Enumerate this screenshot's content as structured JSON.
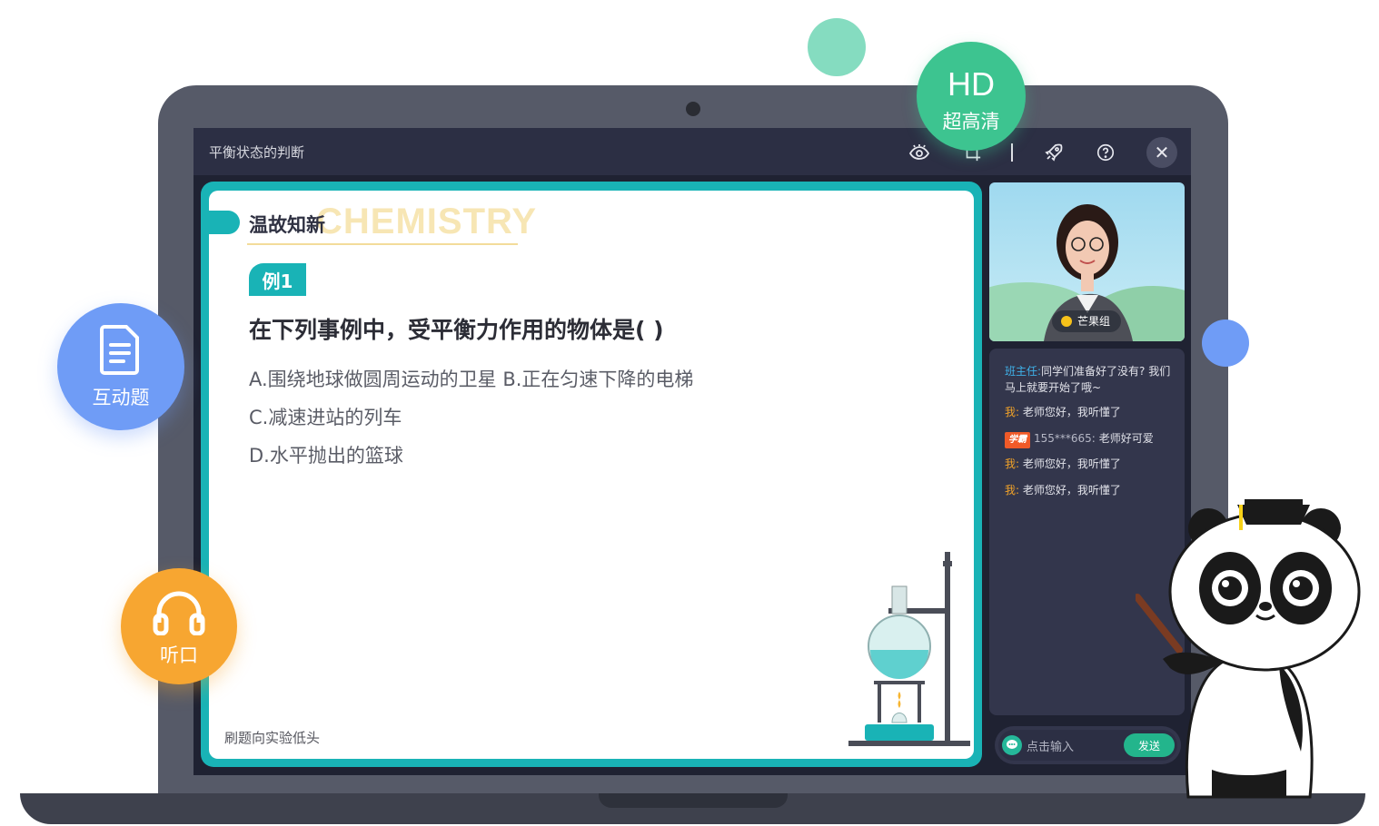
{
  "window": {
    "title": "平衡状态的判断"
  },
  "toolbar": {
    "icons": [
      "eye-icon",
      "crop-icon",
      "rocket-icon",
      "help-icon"
    ],
    "close_glyph": "✕"
  },
  "slide": {
    "section_title": "温故知新",
    "watermark": "CHEMISTRY",
    "example_label": "例1",
    "question": "在下列事例中，受平衡力作用的物体是(   )",
    "options": [
      "A.围绕地球做圆周运动的卫星 B.正在匀速下降的电梯",
      "C.减速进站的列车",
      "D.水平抛出的篮球"
    ],
    "footer": "刷题向实验低头"
  },
  "video": {
    "name": "芒果组"
  },
  "chat": {
    "messages": [
      {
        "name": "班主任:",
        "text": "同学们准备好了没有? 我们马上就要开始了哦~"
      },
      {
        "name": "我:",
        "text": "老师您好，我听懂了"
      },
      {
        "badge": "学霸",
        "user": "155***665:",
        "text": "老师好可爱"
      },
      {
        "name": "我:",
        "text": "老师您好，我听懂了"
      },
      {
        "name": "我:",
        "text": "老师您好，我听懂了"
      }
    ],
    "input_placeholder": "点击输入",
    "send_label": "发送"
  },
  "badges": {
    "hd_main": "HD",
    "hd_sub": "超高清",
    "interactive": "互动题",
    "listen": "听口"
  },
  "colors": {
    "accent_teal": "#19b3b6",
    "hd_green": "#3dc490",
    "blue": "#6f9cf6",
    "orange": "#f7a631"
  }
}
